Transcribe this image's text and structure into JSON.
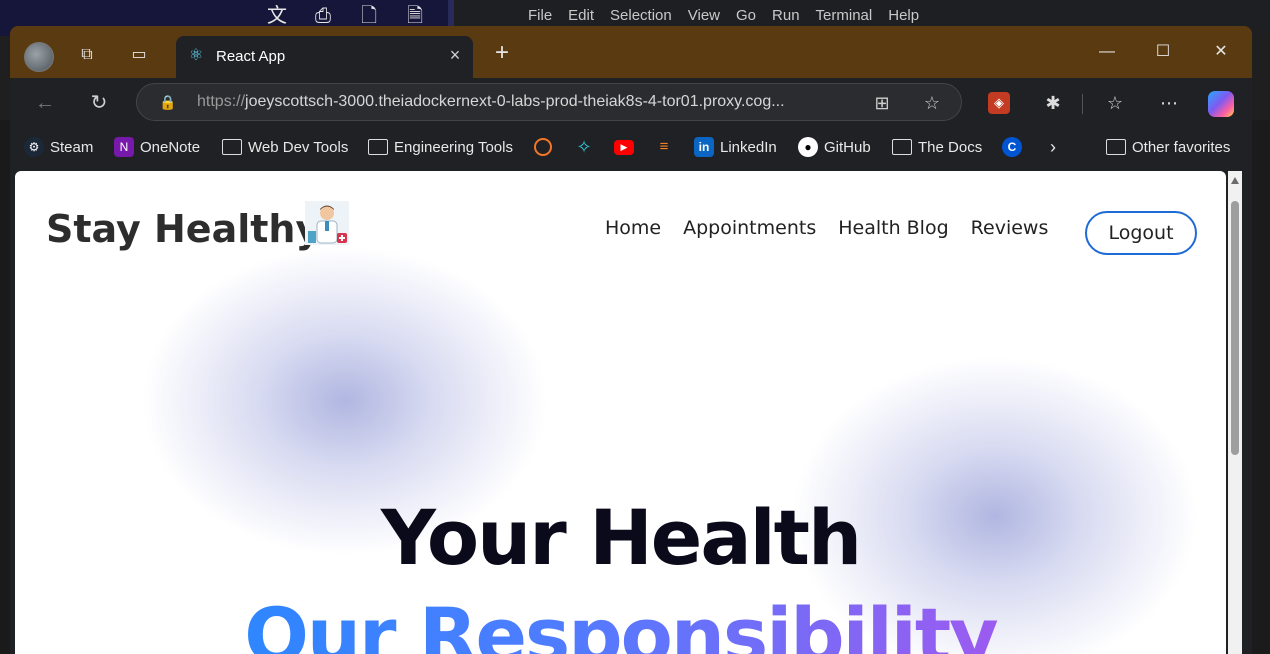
{
  "ide": {
    "menu": [
      "File",
      "Edit",
      "Selection",
      "View",
      "Go",
      "Run",
      "Terminal",
      "Help"
    ],
    "toolbar_icons": [
      "translate-icon",
      "print-icon",
      "new-file-icon",
      "file-icon"
    ]
  },
  "browser": {
    "tab": {
      "title": "React App",
      "icon": "react-icon"
    },
    "address": {
      "proto": "https://",
      "rest": "joeyscottsch-3000.theiadockernext-0-labs-prod-theiak8s-4-tor01.proxy.cog..."
    },
    "bookmarks": [
      {
        "label": "Steam",
        "icon": "steam-icon",
        "color": "#1b2838"
      },
      {
        "label": "OneNote",
        "icon": "onenote-icon",
        "color": "#7719aa"
      },
      {
        "label": "Web Dev Tools",
        "icon": "folder-icon",
        "color": ""
      },
      {
        "label": "Engineering Tools",
        "icon": "folder-icon",
        "color": ""
      },
      {
        "label": "",
        "icon": "jupyter-icon",
        "color": "#f37626"
      },
      {
        "label": "",
        "icon": "sparkle-icon",
        "color": "#2ec4d6"
      },
      {
        "label": "",
        "icon": "youtube-icon",
        "color": "#ff0000"
      },
      {
        "label": "",
        "icon": "stackoverflow-icon",
        "color": "#f48024"
      },
      {
        "label": "LinkedIn",
        "icon": "linkedin-icon",
        "color": "#0a66c2"
      },
      {
        "label": "GitHub",
        "icon": "github-icon",
        "color": "#ffffff"
      },
      {
        "label": "The Docs",
        "icon": "folder-icon",
        "color": ""
      },
      {
        "label": "",
        "icon": "coursera-icon",
        "color": "#0056d2"
      }
    ],
    "other_favorites": "Other favorites"
  },
  "page": {
    "logo": "Stay Healthy",
    "nav": [
      "Home",
      "Appointments",
      "Health Blog",
      "Reviews"
    ],
    "logout": "Logout",
    "hero_line1": "Your Health",
    "hero_line2": "Our Responsibility"
  }
}
